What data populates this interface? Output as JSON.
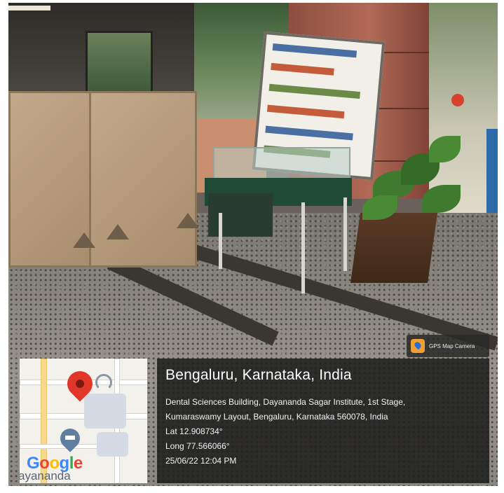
{
  "badge": {
    "label": "GPS Map Camera"
  },
  "map": {
    "brand": [
      "G",
      "o",
      "o",
      "g",
      "l",
      "e"
    ],
    "place_fragment": "ayananda"
  },
  "location": {
    "title": "Bengaluru, Karnataka, India",
    "address_line1": "Dental Sciences Building, Dayananda Sagar Institute, 1st Stage,",
    "address_line2": "Kumaraswamy Layout, Bengaluru, Karnataka 560078, India",
    "lat": "Lat 12.908734°",
    "long": "Long 77.566066°",
    "datetime": "25/06/22 12:04 PM"
  },
  "colors": {
    "pin": "#e0372a",
    "overlay": "#1e1e1e"
  },
  "icons": [
    "location-pin-icon",
    "school-pin-icon",
    "gps-map-camera-icon"
  ]
}
